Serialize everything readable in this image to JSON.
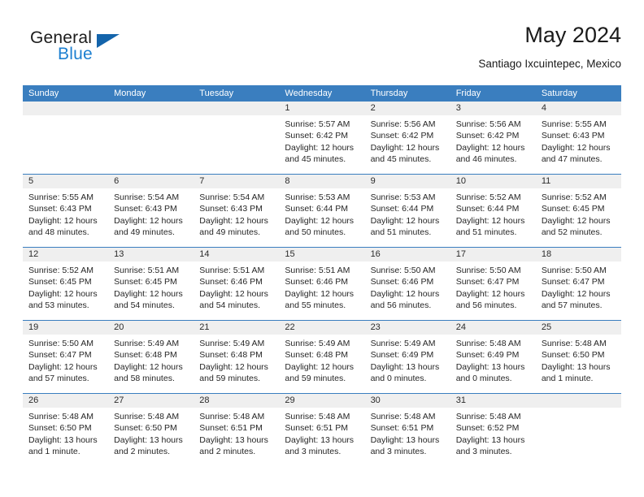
{
  "logo": {
    "word_one": "General",
    "word_two": "Blue",
    "icon": "triangle-flag-icon"
  },
  "header": {
    "title": "May 2024",
    "subtitle": "Santiago Ixcuintepec, Mexico"
  },
  "colors": {
    "header_blue": "#3a7ebf",
    "daynum_gray": "#efefef",
    "logo_blue": "#1c7fd0",
    "logo_triangle": "#1464ab",
    "text": "#262626"
  },
  "weekday_headers": [
    "Sunday",
    "Monday",
    "Tuesday",
    "Wednesday",
    "Thursday",
    "Friday",
    "Saturday"
  ],
  "weeks": [
    [
      {
        "day": "",
        "lines": []
      },
      {
        "day": "",
        "lines": []
      },
      {
        "day": "",
        "lines": []
      },
      {
        "day": "1",
        "lines": [
          "Sunrise: 5:57 AM",
          "Sunset: 6:42 PM",
          "Daylight: 12 hours",
          "and 45 minutes."
        ]
      },
      {
        "day": "2",
        "lines": [
          "Sunrise: 5:56 AM",
          "Sunset: 6:42 PM",
          "Daylight: 12 hours",
          "and 45 minutes."
        ]
      },
      {
        "day": "3",
        "lines": [
          "Sunrise: 5:56 AM",
          "Sunset: 6:42 PM",
          "Daylight: 12 hours",
          "and 46 minutes."
        ]
      },
      {
        "day": "4",
        "lines": [
          "Sunrise: 5:55 AM",
          "Sunset: 6:43 PM",
          "Daylight: 12 hours",
          "and 47 minutes."
        ]
      }
    ],
    [
      {
        "day": "5",
        "lines": [
          "Sunrise: 5:55 AM",
          "Sunset: 6:43 PM",
          "Daylight: 12 hours",
          "and 48 minutes."
        ]
      },
      {
        "day": "6",
        "lines": [
          "Sunrise: 5:54 AM",
          "Sunset: 6:43 PM",
          "Daylight: 12 hours",
          "and 49 minutes."
        ]
      },
      {
        "day": "7",
        "lines": [
          "Sunrise: 5:54 AM",
          "Sunset: 6:43 PM",
          "Daylight: 12 hours",
          "and 49 minutes."
        ]
      },
      {
        "day": "8",
        "lines": [
          "Sunrise: 5:53 AM",
          "Sunset: 6:44 PM",
          "Daylight: 12 hours",
          "and 50 minutes."
        ]
      },
      {
        "day": "9",
        "lines": [
          "Sunrise: 5:53 AM",
          "Sunset: 6:44 PM",
          "Daylight: 12 hours",
          "and 51 minutes."
        ]
      },
      {
        "day": "10",
        "lines": [
          "Sunrise: 5:52 AM",
          "Sunset: 6:44 PM",
          "Daylight: 12 hours",
          "and 51 minutes."
        ]
      },
      {
        "day": "11",
        "lines": [
          "Sunrise: 5:52 AM",
          "Sunset: 6:45 PM",
          "Daylight: 12 hours",
          "and 52 minutes."
        ]
      }
    ],
    [
      {
        "day": "12",
        "lines": [
          "Sunrise: 5:52 AM",
          "Sunset: 6:45 PM",
          "Daylight: 12 hours",
          "and 53 minutes."
        ]
      },
      {
        "day": "13",
        "lines": [
          "Sunrise: 5:51 AM",
          "Sunset: 6:45 PM",
          "Daylight: 12 hours",
          "and 54 minutes."
        ]
      },
      {
        "day": "14",
        "lines": [
          "Sunrise: 5:51 AM",
          "Sunset: 6:46 PM",
          "Daylight: 12 hours",
          "and 54 minutes."
        ]
      },
      {
        "day": "15",
        "lines": [
          "Sunrise: 5:51 AM",
          "Sunset: 6:46 PM",
          "Daylight: 12 hours",
          "and 55 minutes."
        ]
      },
      {
        "day": "16",
        "lines": [
          "Sunrise: 5:50 AM",
          "Sunset: 6:46 PM",
          "Daylight: 12 hours",
          "and 56 minutes."
        ]
      },
      {
        "day": "17",
        "lines": [
          "Sunrise: 5:50 AM",
          "Sunset: 6:47 PM",
          "Daylight: 12 hours",
          "and 56 minutes."
        ]
      },
      {
        "day": "18",
        "lines": [
          "Sunrise: 5:50 AM",
          "Sunset: 6:47 PM",
          "Daylight: 12 hours",
          "and 57 minutes."
        ]
      }
    ],
    [
      {
        "day": "19",
        "lines": [
          "Sunrise: 5:50 AM",
          "Sunset: 6:47 PM",
          "Daylight: 12 hours",
          "and 57 minutes."
        ]
      },
      {
        "day": "20",
        "lines": [
          "Sunrise: 5:49 AM",
          "Sunset: 6:48 PM",
          "Daylight: 12 hours",
          "and 58 minutes."
        ]
      },
      {
        "day": "21",
        "lines": [
          "Sunrise: 5:49 AM",
          "Sunset: 6:48 PM",
          "Daylight: 12 hours",
          "and 59 minutes."
        ]
      },
      {
        "day": "22",
        "lines": [
          "Sunrise: 5:49 AM",
          "Sunset: 6:48 PM",
          "Daylight: 12 hours",
          "and 59 minutes."
        ]
      },
      {
        "day": "23",
        "lines": [
          "Sunrise: 5:49 AM",
          "Sunset: 6:49 PM",
          "Daylight: 13 hours",
          "and 0 minutes."
        ]
      },
      {
        "day": "24",
        "lines": [
          "Sunrise: 5:48 AM",
          "Sunset: 6:49 PM",
          "Daylight: 13 hours",
          "and 0 minutes."
        ]
      },
      {
        "day": "25",
        "lines": [
          "Sunrise: 5:48 AM",
          "Sunset: 6:50 PM",
          "Daylight: 13 hours",
          "and 1 minute."
        ]
      }
    ],
    [
      {
        "day": "26",
        "lines": [
          "Sunrise: 5:48 AM",
          "Sunset: 6:50 PM",
          "Daylight: 13 hours",
          "and 1 minute."
        ]
      },
      {
        "day": "27",
        "lines": [
          "Sunrise: 5:48 AM",
          "Sunset: 6:50 PM",
          "Daylight: 13 hours",
          "and 2 minutes."
        ]
      },
      {
        "day": "28",
        "lines": [
          "Sunrise: 5:48 AM",
          "Sunset: 6:51 PM",
          "Daylight: 13 hours",
          "and 2 minutes."
        ]
      },
      {
        "day": "29",
        "lines": [
          "Sunrise: 5:48 AM",
          "Sunset: 6:51 PM",
          "Daylight: 13 hours",
          "and 3 minutes."
        ]
      },
      {
        "day": "30",
        "lines": [
          "Sunrise: 5:48 AM",
          "Sunset: 6:51 PM",
          "Daylight: 13 hours",
          "and 3 minutes."
        ]
      },
      {
        "day": "31",
        "lines": [
          "Sunrise: 5:48 AM",
          "Sunset: 6:52 PM",
          "Daylight: 13 hours",
          "and 3 minutes."
        ]
      },
      {
        "day": "",
        "lines": []
      }
    ]
  ]
}
